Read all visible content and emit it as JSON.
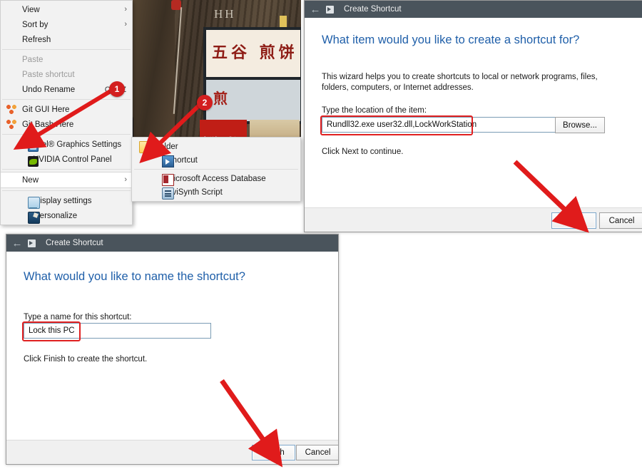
{
  "colors": {
    "accent_red": "#d31f1f",
    "title_bar": "#4a545c",
    "heading_blue": "#1f5fa9",
    "menu_bg": "#f2f2f2",
    "highlight_box": "#e02020"
  },
  "desktop": {
    "photo_alt": "street-food-stall-photo",
    "sign_text_1": "五谷 煎饼",
    "sign_text_2": "煎",
    "poster_text": "新潮 武汉",
    "hh_text": "HH"
  },
  "context_menu": {
    "items": [
      {
        "label": "View",
        "submenu": true,
        "disabled": false,
        "accel": "",
        "icon": ""
      },
      {
        "label": "Sort by",
        "submenu": true,
        "disabled": false,
        "accel": "",
        "icon": ""
      },
      {
        "label": "Refresh",
        "submenu": false,
        "disabled": false,
        "accel": "",
        "icon": ""
      },
      {
        "label": "Paste",
        "submenu": false,
        "disabled": true,
        "accel": "",
        "icon": ""
      },
      {
        "label": "Paste shortcut",
        "submenu": false,
        "disabled": true,
        "accel": "",
        "icon": ""
      },
      {
        "label": "Undo Rename",
        "submenu": false,
        "disabled": false,
        "accel": "Ctrl+Z",
        "icon": ""
      },
      {
        "label": "Git GUI Here",
        "submenu": false,
        "disabled": false,
        "accel": "",
        "icon": "git-icon"
      },
      {
        "label": "Git Bash Here",
        "submenu": false,
        "disabled": false,
        "accel": "",
        "icon": "git-icon"
      },
      {
        "label": "Intel® Graphics Settings",
        "submenu": false,
        "disabled": false,
        "accel": "",
        "icon": "intel-icon"
      },
      {
        "label": "NVIDIA Control Panel",
        "submenu": false,
        "disabled": false,
        "accel": "",
        "icon": "nvidia-icon"
      },
      {
        "label": "New",
        "submenu": true,
        "disabled": false,
        "accel": "",
        "icon": ""
      },
      {
        "label": "Display settings",
        "submenu": false,
        "disabled": false,
        "accel": "",
        "icon": "display-icon"
      },
      {
        "label": "Personalize",
        "submenu": false,
        "disabled": false,
        "accel": "",
        "icon": "personalize-icon"
      }
    ],
    "chevron": "›"
  },
  "new_submenu": {
    "items": [
      {
        "label": "Folder",
        "icon": "folder-icon"
      },
      {
        "label": "Shortcut",
        "icon": "shortcut-icon"
      },
      {
        "label": "Microsoft Access Database",
        "icon": "access-database-icon"
      },
      {
        "label": "AviSynth Script",
        "icon": "avisynth-script-icon"
      }
    ]
  },
  "wizard_location": {
    "window_title": "Create Shortcut",
    "back_arrow": "←",
    "heading": "What item would you like to create a shortcut for?",
    "description": "This wizard helps you to create shortcuts to local or network programs, files, folders, computers, or Internet addresses.",
    "field_label": "Type the location of the item:",
    "field_value": "Rundll32.exe user32.dll,LockWorkStation",
    "browse_button": "Browse...",
    "hint": "Click Next to continue.",
    "next_button": "Next",
    "cancel_button": "Cancel"
  },
  "wizard_name": {
    "window_title": "Create Shortcut",
    "back_arrow": "←",
    "heading": "What would you like to name the shortcut?",
    "field_label": "Type a name for this shortcut:",
    "field_value": "Lock this PC",
    "hint": "Click Finish to create the shortcut.",
    "finish_button": "Finish",
    "cancel_button": "Cancel"
  },
  "annotations": {
    "badges": [
      {
        "number": "1",
        "target": "new-menu-item"
      },
      {
        "number": "2",
        "target": "shortcut-submenu-item"
      }
    ],
    "arrows": 4
  }
}
